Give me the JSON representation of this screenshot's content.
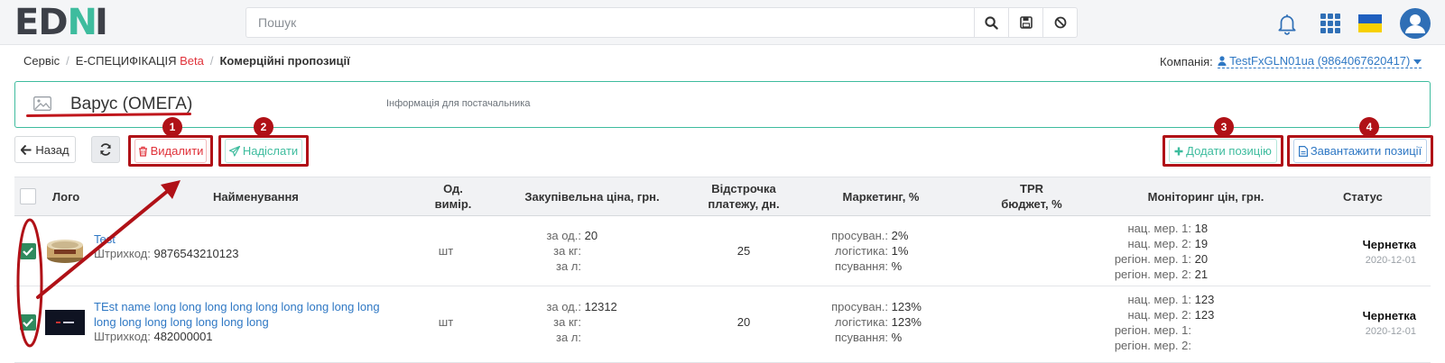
{
  "app": {
    "logo_a": "ED",
    "logo_b": "N",
    "logo_c": "I",
    "search_placeholder": "Пошук"
  },
  "breadcrumb": {
    "item1": "Сервіс",
    "item2": "Е-СПЕЦИФІКАЦІЯ",
    "item2_badge": "Beta",
    "item3": "Комерційні пропозиції"
  },
  "company": {
    "label": "Компанія:",
    "value": "TestFxGLN01ua (9864067620417)"
  },
  "supplier": {
    "name": "Варус (ОМЕГА)",
    "info": "Інформація для постачальника"
  },
  "toolbar": {
    "back": "Назад",
    "delete": "Видалити",
    "send": "Надіслати",
    "add": "Додати позицію",
    "upload": "Завантажити позиції"
  },
  "annotations": [
    "1",
    "2",
    "3",
    "4"
  ],
  "table": {
    "headers": {
      "logo": "Лого",
      "name": "Найменування",
      "unit_1": "Од.",
      "unit_2": "вимір.",
      "price": "Закупівельна ціна, грн.",
      "defer_1": "Відстрочка",
      "defer_2": "платежу, дн.",
      "marketing": "Маркетинг, %",
      "tpr_1": "TPR",
      "tpr_2": "бюджет, %",
      "monitor": "Моніторинг цін, грн.",
      "status": "Статус"
    },
    "price_labels": [
      "за од.:",
      "за кг:",
      "за л:"
    ],
    "marketing_labels": [
      "просуван.:",
      "логістика:",
      "псування:"
    ],
    "monitor_labels": [
      "нац. мер. 1:",
      "нац. мер. 2:",
      "регіон. мер. 1:",
      "регіон. мер. 2:"
    ],
    "barcode_label": "Штрихкод:",
    "rows": [
      {
        "name": "Test",
        "barcode": "9876543210123",
        "unit": "шт",
        "price_unit": "20",
        "price_kg": "",
        "price_l": "",
        "deferral": "25",
        "mk_promo": "2%",
        "mk_log": "1%",
        "mk_spoil": "%",
        "mon1": "18",
        "mon2": "19",
        "mon3": "20",
        "mon4": "21",
        "status": "Чернетка",
        "date": "2020-12-01",
        "checked": true
      },
      {
        "name_line1": "TEst name long long long long long long long long long",
        "name_line2": "long long long long long long long",
        "barcode": "482000001",
        "unit": "шт",
        "price_unit": "12312",
        "price_kg": "",
        "price_l": "",
        "deferral": "20",
        "mk_promo": "123%",
        "mk_log": "123%",
        "mk_spoil": "%",
        "mon1": "123",
        "mon2": "123",
        "mon3": "",
        "mon4": "",
        "status": "Чернетка",
        "date": "2020-12-01",
        "checked": true
      }
    ]
  },
  "colors": {
    "accent": "#3ebc9e",
    "link": "#2f78c4",
    "danger": "#e0323a",
    "annotation": "#b01117",
    "checkbox": "#2f8a5e"
  }
}
